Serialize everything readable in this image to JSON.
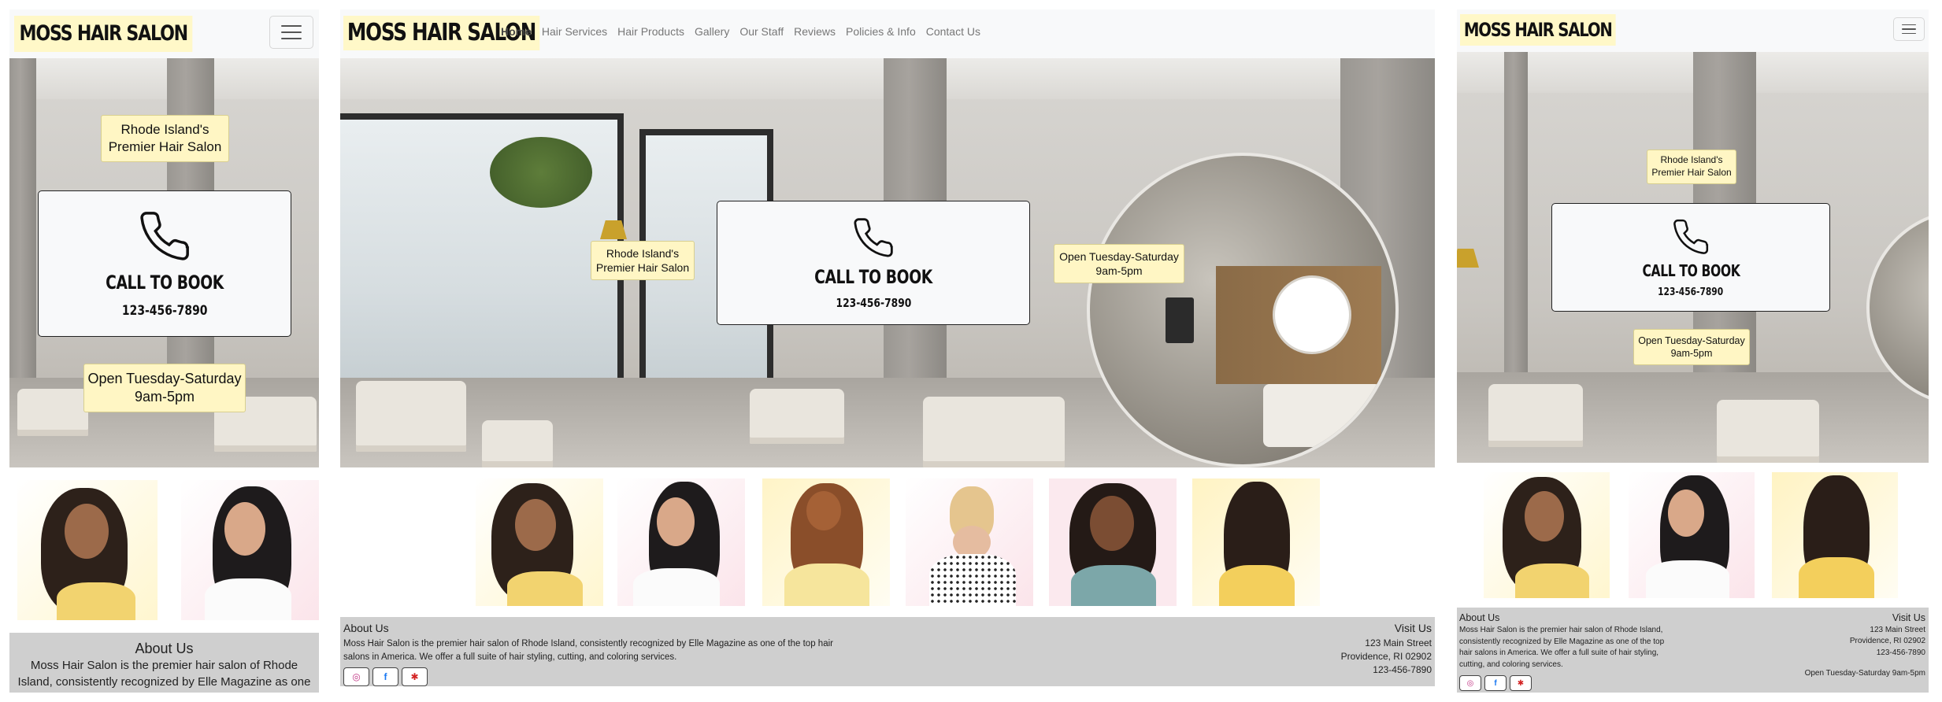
{
  "brand": "MOSS HAIR SALON",
  "nav": {
    "links": [
      "Home",
      "Hair Services",
      "Hair Products",
      "Gallery",
      "Our Staff",
      "Reviews",
      "Policies & Info",
      "Contact Us"
    ],
    "active": "Home"
  },
  "hero": {
    "premier_line1": "Rhode Island's",
    "premier_line2": "Premier Hair Salon",
    "call_title": "CALL TO BOOK",
    "phone": "123-456-7890",
    "hours_line1": "Open Tuesday-Saturday",
    "hours_line2": "9am-5pm"
  },
  "footer": {
    "about_heading": "About Us",
    "about_text": "Moss Hair Salon is the premier hair salon of Rhode Island, consistently recognized by Elle Magazine as one of the top hair salons in America. We offer a full suite of hair styling, cutting, and coloring services.",
    "about_text_mobile": "Moss Hair Salon is the premier hair salon of Rhode Island, consistently recognized by Elle Magazine as one of the top",
    "visit_heading": "Visit Us",
    "address_line1": "123 Main Street",
    "address_line2": "Providence, RI 02902",
    "phone": "123-456-7890",
    "hours": "Open Tuesday-Saturday 9am-5pm"
  },
  "social": [
    "instagram-icon",
    "facebook-icon",
    "yelp-icon"
  ],
  "colors": {
    "brand_highlight": "#fff8c8",
    "tag_bg": "#fff6c4",
    "navbar_bg": "#f8f9fa",
    "footer_bg": "#cfcfcf"
  }
}
